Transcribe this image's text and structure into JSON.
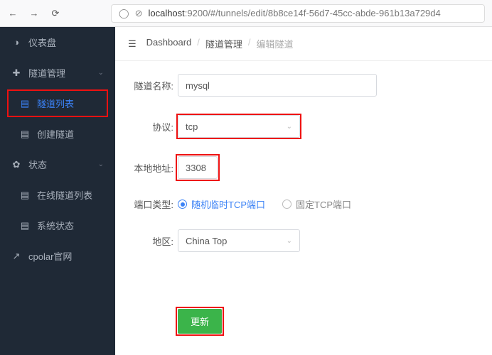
{
  "browser": {
    "url_host": "localhost",
    "url_rest": ":9200/#/tunnels/edit/8b8ce14f-56d7-45cc-abde-961b13a729d4"
  },
  "sidebar": {
    "dashboard": "仪表盘",
    "tunnel_mgmt": "隧道管理",
    "tunnel_list": "隧道列表",
    "create_tunnel": "创建隧道",
    "status": "状态",
    "online_tunnels": "在线隧道列表",
    "system_status": "系统状态",
    "cpolar_site": "cpolar官网"
  },
  "breadcrumb": {
    "dashboard": "Dashboard",
    "tunnel_mgmt": "隧道管理",
    "edit_tunnel": "编辑隧道"
  },
  "form": {
    "name_label": "隧道名称:",
    "name_value": "mysql",
    "proto_label": "协议:",
    "proto_value": "tcp",
    "local_label": "本地地址:",
    "local_value": "3308",
    "port_type_label": "端口类型:",
    "port_type_random": "随机临时TCP端口",
    "port_type_fixed": "固定TCP端口",
    "region_label": "地区:",
    "region_value": "China Top",
    "submit": "更新"
  }
}
